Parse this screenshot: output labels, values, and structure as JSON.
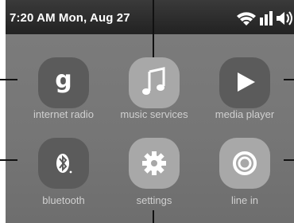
{
  "status_bar": {
    "clock": "7:20 AM Mon, Aug 27",
    "icons": [
      "wifi-icon",
      "signal-bars-icon",
      "speaker-volume-icon"
    ]
  },
  "apps": [
    {
      "label": "internet radio",
      "icon": "internet-radio-g-icon",
      "style": "dark"
    },
    {
      "label": "music services",
      "icon": "music-note-icon",
      "style": "light"
    },
    {
      "label": "media player",
      "icon": "play-icon",
      "style": "dark"
    },
    {
      "label": "bluetooth",
      "icon": "bluetooth-icon",
      "style": "dark"
    },
    {
      "label": "settings",
      "icon": "gear-icon",
      "style": "light"
    },
    {
      "label": "line in",
      "icon": "line-in-ring-icon",
      "style": "light"
    }
  ]
}
